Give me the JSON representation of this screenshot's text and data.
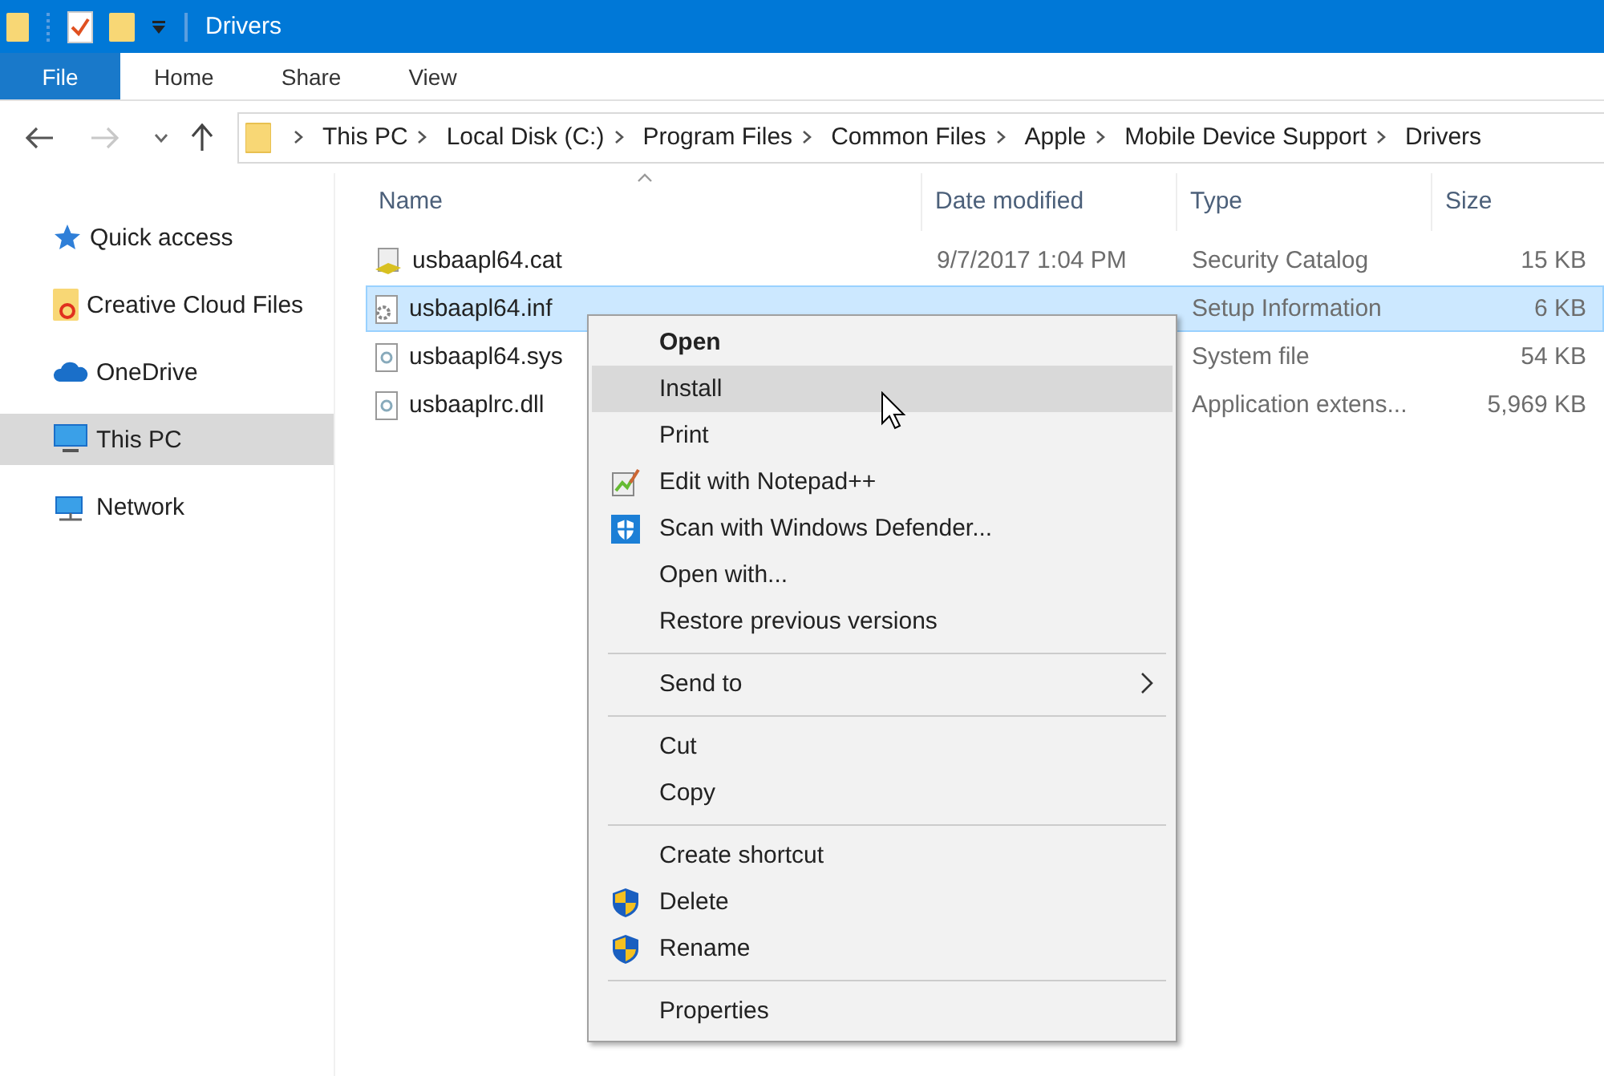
{
  "window": {
    "title": "Drivers"
  },
  "ribbon_tabs": [
    {
      "label": "File",
      "kind": "file",
      "selected": false
    },
    {
      "label": "Home",
      "kind": "tab",
      "selected": false
    },
    {
      "label": "Share",
      "kind": "tab",
      "selected": false
    },
    {
      "label": "View",
      "kind": "tab",
      "selected": false
    }
  ],
  "navigation": {
    "back_disabled": false,
    "forward_disabled": true
  },
  "breadcrumbs": [
    "This PC",
    "Local Disk (C:)",
    "Program Files",
    "Common Files",
    "Apple",
    "Mobile Device Support",
    "Drivers"
  ],
  "sidebar": {
    "items": [
      {
        "label": "Quick access",
        "kind": "star",
        "selected": false
      },
      {
        "label": "Creative Cloud Files",
        "kind": "cloud-folder",
        "selected": false
      },
      {
        "label": "OneDrive",
        "kind": "cloud",
        "selected": false
      },
      {
        "label": "This PC",
        "kind": "computer",
        "selected": true
      },
      {
        "label": "Network",
        "kind": "network",
        "selected": false
      }
    ]
  },
  "table": {
    "columns": [
      "Name",
      "Date modified",
      "Type",
      "Size"
    ],
    "rows": [
      {
        "name": "usbaapl64.cat",
        "kind": "catalog",
        "date": "9/7/2017 1:04 PM",
        "type": "Security Catalog",
        "size": "15 KB",
        "selected": false
      },
      {
        "name": "usbaapl64.inf",
        "kind": "settings-file",
        "type": "Setup Information",
        "size": "6 KB",
        "selected": true
      },
      {
        "name": "usbaapl64.sys",
        "kind": "system-file",
        "type": "System file",
        "size": "54 KB",
        "selected": false
      },
      {
        "name": "usbaaplrc.dll",
        "kind": "system-file",
        "type": "Application extens...",
        "size": "5,969 KB",
        "selected": false
      }
    ]
  },
  "context_menu": {
    "items": [
      {
        "kind": "item",
        "label": "Open",
        "bold": true,
        "hovered": false
      },
      {
        "kind": "item",
        "label": "Install",
        "bold": false,
        "hovered": true
      },
      {
        "kind": "item",
        "label": "Print",
        "bold": false,
        "hovered": false
      },
      {
        "kind": "notepad-item",
        "label": "Edit with Notepad++",
        "bold": false,
        "hovered": false
      },
      {
        "kind": "defender-item",
        "label": "Scan with Windows Defender...",
        "bold": false,
        "hovered": false
      },
      {
        "kind": "item",
        "label": "Open with...",
        "bold": false,
        "hovered": false
      },
      {
        "kind": "item",
        "label": "Restore previous versions",
        "bold": false,
        "hovered": false
      },
      {
        "kind": "separator"
      },
      {
        "kind": "submenu",
        "label": "Send to",
        "bold": false,
        "hovered": false
      },
      {
        "kind": "separator"
      },
      {
        "kind": "item",
        "label": "Cut",
        "bold": false,
        "hovered": false
      },
      {
        "kind": "item",
        "label": "Copy",
        "bold": false,
        "hovered": false
      },
      {
        "kind": "separator"
      },
      {
        "kind": "item",
        "label": "Create shortcut",
        "bold": false,
        "hovered": false
      },
      {
        "kind": "shield-item",
        "label": "Delete",
        "bold": false,
        "hovered": false
      },
      {
        "kind": "shield-item",
        "label": "Rename",
        "bold": false,
        "hovered": false
      },
      {
        "kind": "separator"
      },
      {
        "kind": "item",
        "label": "Properties",
        "bold": false,
        "hovered": false
      }
    ]
  }
}
